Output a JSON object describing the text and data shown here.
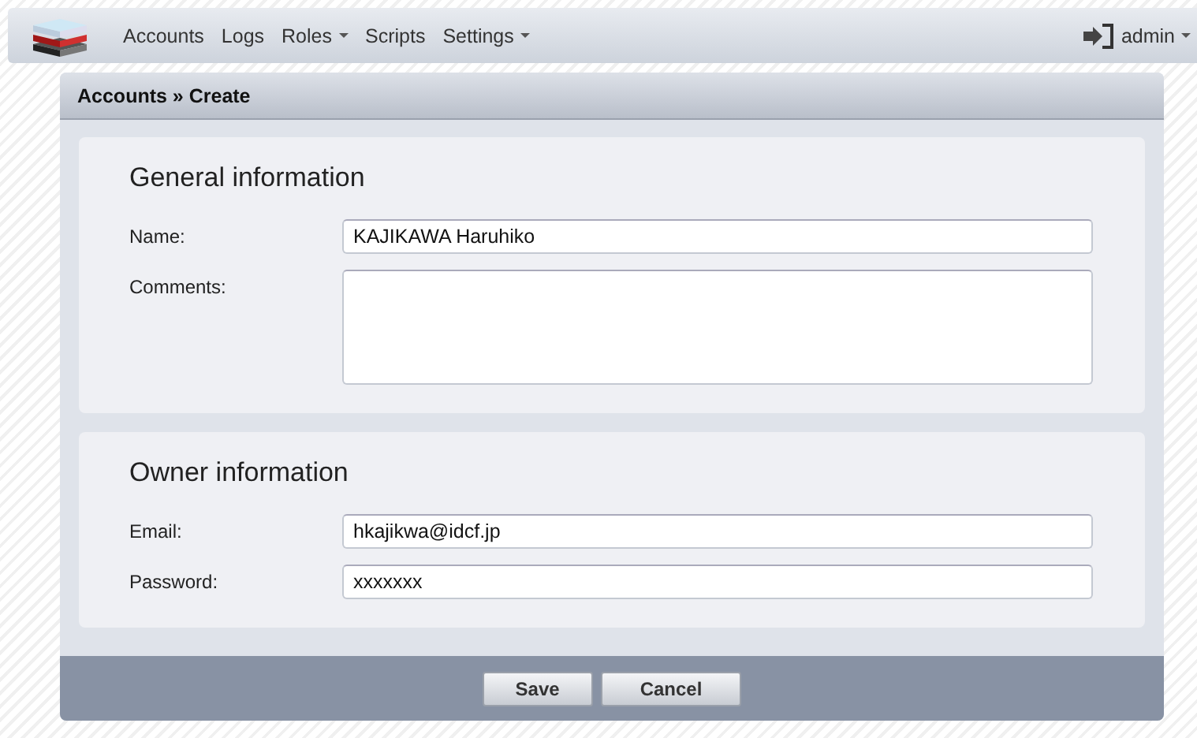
{
  "navbar": {
    "items": [
      {
        "label": "Accounts",
        "dropdown": false
      },
      {
        "label": "Logs",
        "dropdown": false
      },
      {
        "label": "Roles",
        "dropdown": true
      },
      {
        "label": "Scripts",
        "dropdown": false
      },
      {
        "label": "Settings",
        "dropdown": true
      }
    ],
    "user": {
      "label": "admin",
      "dropdown": true
    }
  },
  "breadcrumb": "Accounts » Create",
  "sections": [
    {
      "title": "General information",
      "fields": [
        {
          "kind": "text",
          "label": "Name:",
          "value": "KAJIKAWA Haruhiko"
        },
        {
          "kind": "textarea",
          "label": "Comments:"
        }
      ]
    },
    {
      "title": "Owner information",
      "fields": [
        {
          "kind": "text",
          "label": "Email:",
          "value": "hkajikwa@idcf.jp"
        },
        {
          "kind": "text",
          "label": "Password:",
          "value": "xxxxxxx"
        }
      ]
    }
  ],
  "buttons": [
    "Save",
    "Cancel"
  ]
}
